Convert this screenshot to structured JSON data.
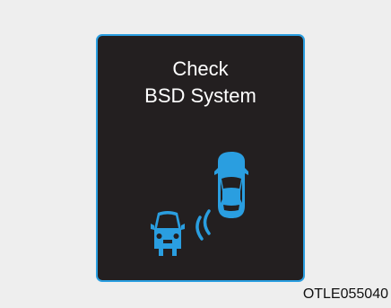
{
  "warning": {
    "line1": "Check",
    "line2": "BSD System"
  },
  "icons": {
    "ego_vehicle": "car-top-view-icon",
    "approaching_vehicle": "car-rear-view-icon",
    "sensor_waves": "radar-waves-icon"
  },
  "colors": {
    "background": "#eeeeee",
    "panel": "#231f20",
    "border": "#2a9ee0",
    "icon": "#2a9ee0",
    "text": "#ffffff"
  },
  "caption": "OTLE055040"
}
